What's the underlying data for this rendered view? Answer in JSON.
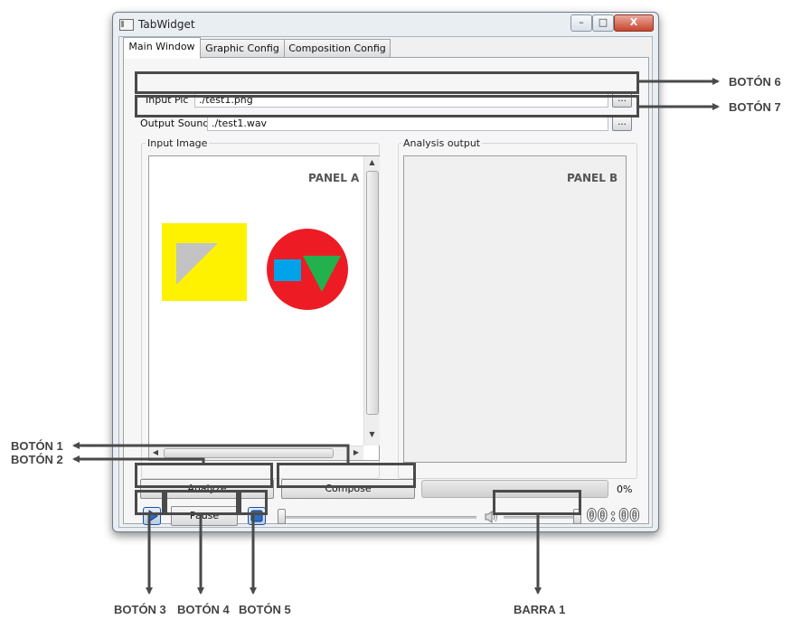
{
  "window": {
    "title": "TabWidget",
    "controls": {
      "minimize": "–",
      "maximize": "□",
      "close": "X"
    }
  },
  "tabs": [
    {
      "label": "Main Window",
      "active": true
    },
    {
      "label": "Graphic Config",
      "active": false
    },
    {
      "label": "Composition Config",
      "active": false
    }
  ],
  "input_pic": {
    "label": "Input Pic",
    "value": "./test1.png",
    "browse_label": "..."
  },
  "output_sound": {
    "label": "Output Sound",
    "value": "./test1.wav",
    "browse_label": "..."
  },
  "groups": {
    "input_image": "Input Image",
    "analysis_output": "Analysis output"
  },
  "panels": {
    "a_label": "PANEL A",
    "b_label": "PANEL B"
  },
  "image_shapes": {
    "colors": {
      "yellow": "#fff200",
      "gray": "#c3c3c3",
      "red": "#ed1c24",
      "blue": "#00a2e8",
      "green": "#22b14c"
    }
  },
  "buttons": {
    "analyze": "Analyze",
    "compose": "Compose",
    "pause": "Pause"
  },
  "progress": {
    "value_text": "0%",
    "value": 0
  },
  "player": {
    "time": "00:00",
    "volume_level": 1.0,
    "seek_level": 0.0
  },
  "annotations": {
    "boton1": "BOTÓN 1",
    "boton2": "BOTÓN 2",
    "boton3": "BOTÓN 3",
    "boton4": "BOTÓN 4",
    "boton5": "BOTÓN 5",
    "boton6": "BOTÓN 6",
    "boton7": "BOTÓN 7",
    "barra1": "BARRA 1"
  },
  "colors": {
    "annotation": "#4a4a4a",
    "accent": "#2b6cc4"
  }
}
